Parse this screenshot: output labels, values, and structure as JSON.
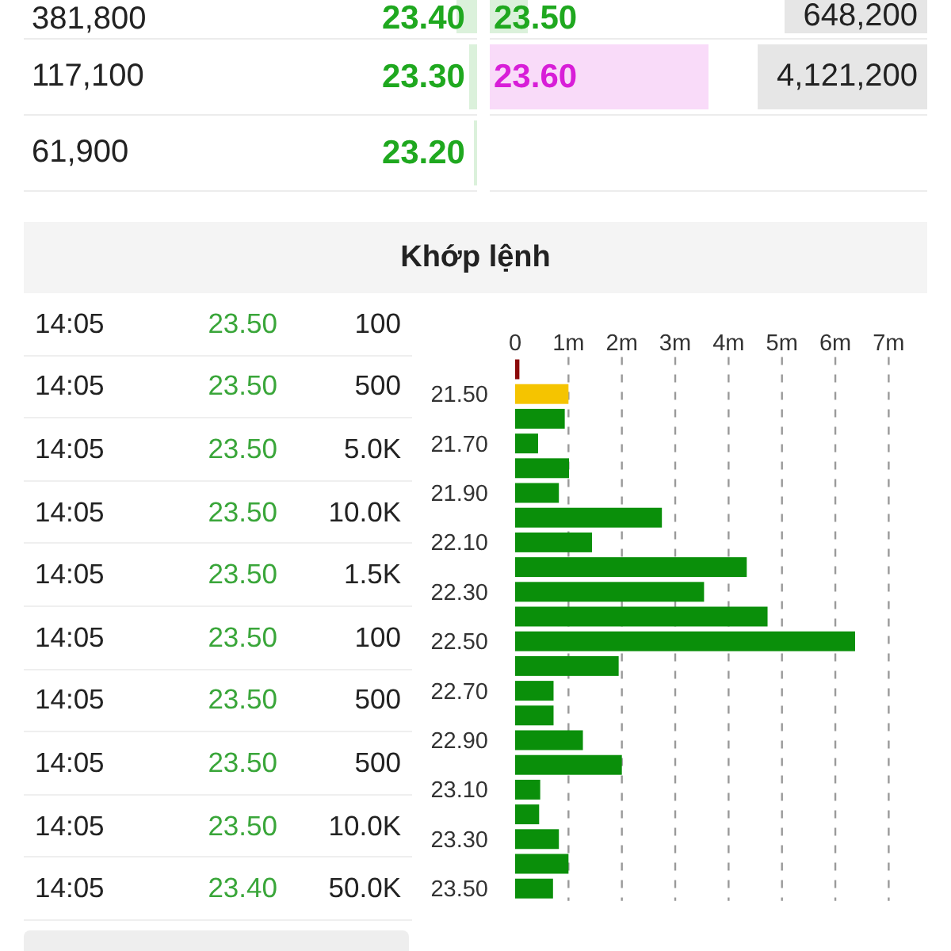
{
  "order_book": {
    "rows": [
      {
        "bid": {
          "volume": "381,800",
          "price": "23.40",
          "color": "#1fa81f",
          "level": 0.045,
          "highlighted": false
        },
        "ask": {
          "price": "23.50",
          "color": "#1fa81f",
          "level": 0.09,
          "volume": "648,200",
          "highlighted": true
        }
      },
      {
        "bid": {
          "volume": "117,100",
          "price": "23.30",
          "color": "#1fa81f",
          "level": 0.015,
          "highlighted": false
        },
        "ask": {
          "price": "23.60",
          "color": "#d81ed8",
          "level": 0.5,
          "volume": "4,121,200",
          "highlighted": true
        }
      },
      {
        "bid": {
          "volume": "61,900",
          "price": "23.20",
          "color": "#1fa81f",
          "level": 0.005,
          "highlighted": false
        }
      }
    ]
  },
  "matched_orders": {
    "title": "Khớp lệnh",
    "trades": [
      {
        "time": "14:05",
        "price": "23.50",
        "volume": "100"
      },
      {
        "time": "14:05",
        "price": "23.50",
        "volume": "500"
      },
      {
        "time": "14:05",
        "price": "23.50",
        "volume": "5.0K"
      },
      {
        "time": "14:05",
        "price": "23.50",
        "volume": "10.0K"
      },
      {
        "time": "14:05",
        "price": "23.50",
        "volume": "1.5K"
      },
      {
        "time": "14:05",
        "price": "23.50",
        "volume": "100"
      },
      {
        "time": "14:05",
        "price": "23.50",
        "volume": "500"
      },
      {
        "time": "14:05",
        "price": "23.50",
        "volume": "500"
      },
      {
        "time": "14:05",
        "price": "23.50",
        "volume": "10.0K"
      },
      {
        "time": "14:05",
        "price": "23.40",
        "volume": "50.0K"
      }
    ],
    "chart_data": {
      "type": "bar",
      "orientation": "horizontal",
      "stacked": true,
      "grid": true,
      "x": [
        21.4,
        21.5,
        21.6,
        21.7,
        21.8,
        21.9,
        22.0,
        22.1,
        22.2,
        22.3,
        22.4,
        22.5,
        22.6,
        22.7,
        22.8,
        22.9,
        23.0,
        23.1,
        23.2,
        23.3,
        23.4,
        23.5
      ],
      "series": [
        {
          "color": "#8b0a0a",
          "values": [
            0.08,
            null,
            null,
            null,
            null,
            null,
            null,
            null,
            null,
            null,
            null,
            null,
            null,
            null,
            null,
            null,
            null,
            null,
            null,
            null,
            null,
            null
          ]
        },
        {
          "color": "#f5c400",
          "values": [
            null,
            1.0,
            null,
            null,
            null,
            null,
            null,
            null,
            null,
            null,
            null,
            null,
            null,
            null,
            null,
            null,
            null,
            null,
            null,
            null,
            null,
            null
          ]
        },
        {
          "color": "#0a8f0a",
          "values": [
            null,
            null,
            0.93,
            0.43,
            1.01,
            0.82,
            2.75,
            1.44,
            4.34,
            3.54,
            4.73,
            6.37,
            1.94,
            0.72,
            0.72,
            1.27,
            2.0,
            0.47,
            0.45,
            0.82,
            1.0,
            0.71
          ]
        }
      ],
      "xlim": [
        0,
        7
      ],
      "ylim": [
        23.55,
        21.35
      ],
      "xticks": [
        {
          "value": 0,
          "label": "0"
        },
        {
          "value": 1,
          "label": "1m"
        },
        {
          "value": 2,
          "label": "2m"
        },
        {
          "value": 3,
          "label": "3m"
        },
        {
          "value": 4,
          "label": "4m"
        },
        {
          "value": 5,
          "label": "5m"
        },
        {
          "value": 6,
          "label": "6m"
        },
        {
          "value": 7,
          "label": "7m"
        }
      ],
      "yticks": [
        {
          "value": 21.5,
          "label": "21.50"
        },
        {
          "value": 21.7,
          "label": "21.70"
        },
        {
          "value": 21.9,
          "label": "21.90"
        },
        {
          "value": 22.1,
          "label": "22.10"
        },
        {
          "value": 22.3,
          "label": "22.30"
        },
        {
          "value": 22.5,
          "label": "22.50"
        },
        {
          "value": 22.7,
          "label": "22.70"
        },
        {
          "value": 22.9,
          "label": "22.90"
        },
        {
          "value": 23.1,
          "label": "23.10"
        },
        {
          "value": 23.3,
          "label": "23.30"
        },
        {
          "value": 23.5,
          "label": "23.50"
        }
      ]
    }
  }
}
